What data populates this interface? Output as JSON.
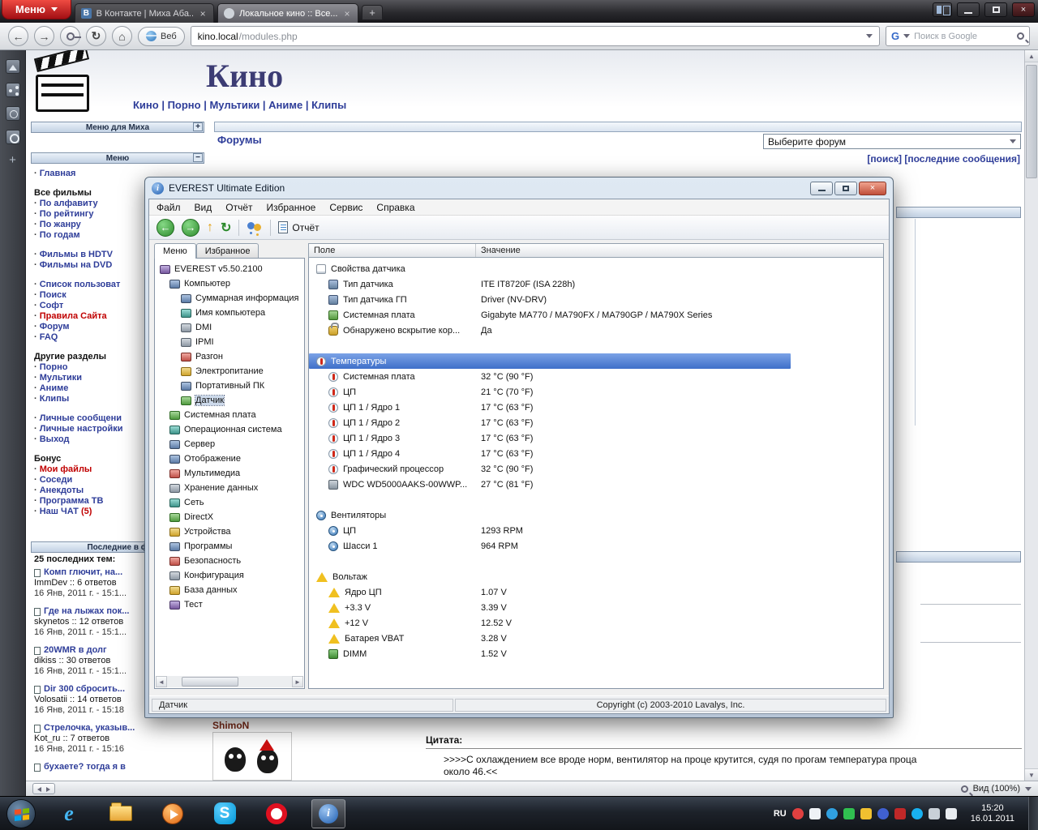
{
  "browser": {
    "menu_button": "Меню",
    "tab1_favicon": "В",
    "tab1": "В Контакте | Миха Аба...",
    "tab2": "Локальное кино :: Все...",
    "address_domain": "kino.local",
    "address_path": "/modules.php",
    "web_button": "Веб",
    "search_text": "Поиск в Google",
    "search_engine_letter": "G"
  },
  "page": {
    "title": "Кино",
    "nav": "Кино | Порно | Мультики | Аниме | Клипы",
    "user_menu_header": "Меню для Миха",
    "menu_header": "Меню",
    "forums_title": "Форумы",
    "forum_select": "Выберите форум",
    "forum_links": "[поиск] [последние сообщения]",
    "recent_header": "Последние в ф",
    "recent_title": "25 последних тем:",
    "menu": [
      {
        "label": "Главная"
      },
      {
        "label": "Все фильмы"
      },
      {
        "label": "По алфавиту"
      },
      {
        "label": "По рейтингу"
      },
      {
        "label": "По жанру"
      },
      {
        "label": "По годам"
      },
      {
        "label": "Фильмы в HDTV"
      },
      {
        "label": "Фильмы на DVD"
      },
      {
        "label": "Список пользоват"
      },
      {
        "label": "Поиск"
      },
      {
        "label": "Софт"
      },
      {
        "label": "Правила Сайта"
      },
      {
        "label": "Форум"
      },
      {
        "label": "FAQ"
      },
      {
        "label": "Другие разделы"
      },
      {
        "label": "Порно"
      },
      {
        "label": "Мультики"
      },
      {
        "label": "Аниме"
      },
      {
        "label": "Клипы"
      },
      {
        "label": "Личные сообщени"
      },
      {
        "label": "Личные настройки"
      },
      {
        "label": "Выход"
      },
      {
        "label": "Бонус"
      },
      {
        "label": "Мои файлы"
      },
      {
        "label": "Соседи"
      },
      {
        "label": "Анекдоты"
      },
      {
        "label": "Программа ТВ"
      },
      {
        "label": "Наш ЧАТ",
        "count": "(5)"
      }
    ],
    "topics": [
      {
        "title": "Комп глючит, на...",
        "meta": "ImmDev :: 6 ответов",
        "date": "16 Янв, 2011 г. - 15:1..."
      },
      {
        "title": "Где на лыжах пок...",
        "meta": "skynetos :: 12 ответов",
        "date": "16 Янв, 2011 г. - 15:1..."
      },
      {
        "title": "20WMR в долг",
        "meta": "dikiss :: 30 ответов",
        "date": "16 Янв, 2011 г. - 15:1..."
      },
      {
        "title": "Dir 300 сбросить...",
        "meta": "Volosatii :: 14 ответов",
        "date": "16 Янв, 2011 г. - 15:18"
      },
      {
        "title": "Стрелочка, указыв...",
        "meta": "Kot_ru :: 7 ответов",
        "date": "16 Янв, 2011 г. - 15:16"
      },
      {
        "title": "бухаете? тогда я в",
        "meta": "",
        "date": ""
      }
    ],
    "quote_author": "ShimoN",
    "quote_label": "Цитата:",
    "quote_text": ">>>>С охлаждением все вроде норм, вентилятор на проце крутится, судя по прогам температура проца около 46.<<"
  },
  "everest": {
    "window_title": "EVEREST Ultimate Edition",
    "menu": [
      "Файл",
      "Вид",
      "Отчёт",
      "Избранное",
      "Сервис",
      "Справка"
    ],
    "report_button": "Отчёт",
    "tab_menu": "Меню",
    "tab_favorites": "Избранное",
    "col_field": "Поле",
    "col_value": "Значение",
    "tree": [
      {
        "label": "EVEREST v5.50.2100"
      },
      {
        "label": "Компьютер"
      },
      {
        "label": "Суммарная информация"
      },
      {
        "label": "Имя компьютера"
      },
      {
        "label": "DMI"
      },
      {
        "label": "IPMI"
      },
      {
        "label": "Разгон"
      },
      {
        "label": "Электропитание"
      },
      {
        "label": "Портативный ПК"
      },
      {
        "label": "Датчик"
      },
      {
        "label": "Системная плата"
      },
      {
        "label": "Операционная система"
      },
      {
        "label": "Сервер"
      },
      {
        "label": "Отображение"
      },
      {
        "label": "Мультимедиа"
      },
      {
        "label": "Хранение данных"
      },
      {
        "label": "Сеть"
      },
      {
        "label": "DirectX"
      },
      {
        "label": "Устройства"
      },
      {
        "label": "Программы"
      },
      {
        "label": "Безопасность"
      },
      {
        "label": "Конфигурация"
      },
      {
        "label": "База данных"
      },
      {
        "label": "Тест"
      }
    ],
    "report": [
      {
        "f": "Свойства датчика"
      },
      {
        "f": "Тип датчика",
        "v": "ITE IT8720F (ISA 228h)"
      },
      {
        "f": "Тип датчика ГП",
        "v": "Driver (NV-DRV)"
      },
      {
        "f": "Системная плата",
        "v": "Gigabyte MA770 / MA790FX / MA790GP / MA790X Series"
      },
      {
        "f": "Обнаружено вскрытие кор...",
        "v": "Да"
      },
      {
        "f": "Температуры"
      },
      {
        "f": "Системная плата",
        "v": "32 °C (90 °F)"
      },
      {
        "f": "ЦП",
        "v": "21 °C (70 °F)"
      },
      {
        "f": "ЦП 1 / Ядро 1",
        "v": "17 °C (63 °F)"
      },
      {
        "f": "ЦП 1 / Ядро 2",
        "v": "17 °C (63 °F)"
      },
      {
        "f": "ЦП 1 / Ядро 3",
        "v": "17 °C (63 °F)"
      },
      {
        "f": "ЦП 1 / Ядро 4",
        "v": "17 °C (63 °F)"
      },
      {
        "f": "Графический процессор",
        "v": "32 °C (90 °F)"
      },
      {
        "f": "WDC WD5000AAKS-00WWP...",
        "v": "27 °C (81 °F)"
      },
      {
        "f": "Вентиляторы"
      },
      {
        "f": "ЦП",
        "v": "1293 RPM"
      },
      {
        "f": "Шасси 1",
        "v": "964 RPM"
      },
      {
        "f": "Вольтаж"
      },
      {
        "f": "Ядро ЦП",
        "v": "1.07 V"
      },
      {
        "f": "+3.3 V",
        "v": "3.39 V"
      },
      {
        "f": "+12 V",
        "v": "12.52 V"
      },
      {
        "f": "Батарея VBAT",
        "v": "3.28 V"
      },
      {
        "f": "DIMM",
        "v": "1.52 V"
      }
    ],
    "status_page": "Датчик",
    "status_copyright": "Copyright (c) 2003-2010 Lavalys, Inc."
  },
  "statusbar": {
    "zoom": "Вид (100%)"
  },
  "taskbar": {
    "lang": "RU",
    "time": "15:20",
    "date": "16.01.2011"
  },
  "glyphs": {
    "close": "×",
    "plus": "+",
    "minus": "−",
    "back": "←",
    "forward": "→",
    "reload": "↻",
    "home": "⌂",
    "up": "↑",
    "info": "i",
    "left": "◄",
    "right": "►",
    "up_small": "▲",
    "down_small": "▼"
  }
}
